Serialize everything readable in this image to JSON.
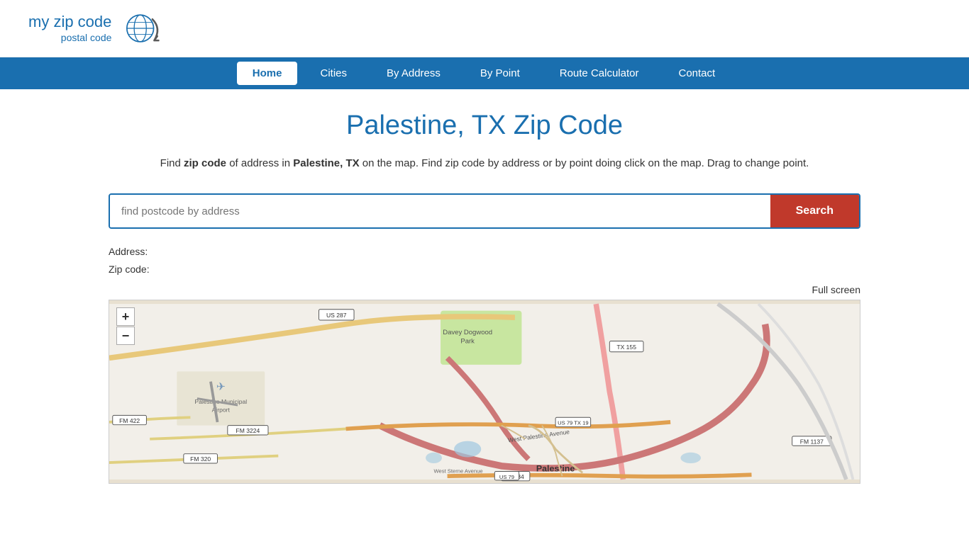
{
  "header": {
    "logo_main": "my zip code",
    "logo_sub": "postal code"
  },
  "nav": {
    "items": [
      {
        "label": "Home",
        "active": true
      },
      {
        "label": "Cities",
        "active": false
      },
      {
        "label": "By Address",
        "active": false
      },
      {
        "label": "By Point",
        "active": false
      },
      {
        "label": "Route Calculator",
        "active": false
      },
      {
        "label": "Contact",
        "active": false
      }
    ]
  },
  "page": {
    "title": "Palestine, TX Zip Code",
    "description_part1": "Find ",
    "description_bold1": "zip code",
    "description_part2": " of address in ",
    "description_bold2": "Palestine, TX",
    "description_part3": " on the map. Find zip code by address or by point doing click on the map. Drag to change point.",
    "search_placeholder": "find postcode by address",
    "search_button_label": "Search",
    "address_label": "Address:",
    "zipcode_label": "Zip code:",
    "fullscreen_label": "Full screen"
  },
  "map": {
    "zoom_in": "+",
    "zoom_out": "−",
    "labels": [
      "US 287",
      "TX 155",
      "FM 422",
      "FM 3224",
      "FM 320",
      "US 79",
      "TX 19",
      "US 84",
      "FM 1137",
      "Davey Dogwood Park",
      "Palestine Municipal Airport",
      "West Palestine Avenue",
      "West Sterne Avenue",
      "Palestine"
    ]
  },
  "colors": {
    "primary": "#1a6faf",
    "nav_bg": "#1a6faf",
    "button_red": "#c0392b",
    "active_nav_text": "#1a6faf"
  }
}
